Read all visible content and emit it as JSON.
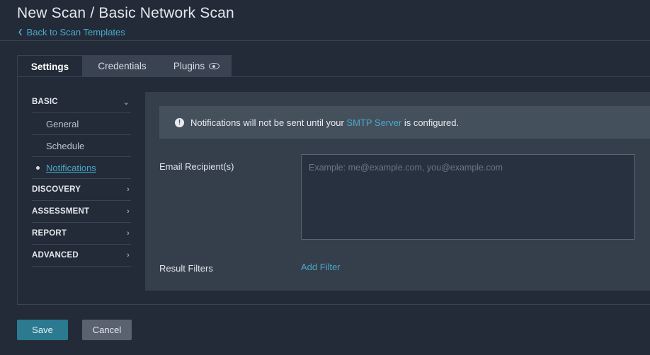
{
  "header": {
    "title": "New Scan / Basic Network Scan",
    "back_link": "Back to Scan Templates"
  },
  "tabs": [
    {
      "label": "Settings",
      "active": true
    },
    {
      "label": "Credentials",
      "active": false
    },
    {
      "label": "Plugins",
      "active": false,
      "icon": "eye-icon"
    }
  ],
  "sidebar": {
    "sections": [
      {
        "label": "BASIC",
        "expanded": true,
        "items": [
          {
            "label": "General"
          },
          {
            "label": "Schedule"
          },
          {
            "label": "Notifications",
            "active": true
          }
        ]
      },
      {
        "label": "DISCOVERY",
        "expanded": false
      },
      {
        "label": "ASSESSMENT",
        "expanded": false
      },
      {
        "label": "REPORT",
        "expanded": false
      },
      {
        "label": "ADVANCED",
        "expanded": false
      }
    ]
  },
  "notice": {
    "icon": "info-icon",
    "text_before": "Notifications will not be sent until your",
    "link": "SMTP Server",
    "text_after": "is configured."
  },
  "form": {
    "email_label": "Email Recipient(s)",
    "email_value": "",
    "email_placeholder": "Example: me@example.com, you@example.com",
    "filters_label": "Result Filters",
    "add_filter": "Add Filter"
  },
  "actions": {
    "save": "Save",
    "cancel": "Cancel"
  },
  "colors": {
    "background": "#232b38",
    "accent_link": "#4aa8c9",
    "primary_button": "#2b7a8f",
    "secondary_button": "#59626e"
  }
}
